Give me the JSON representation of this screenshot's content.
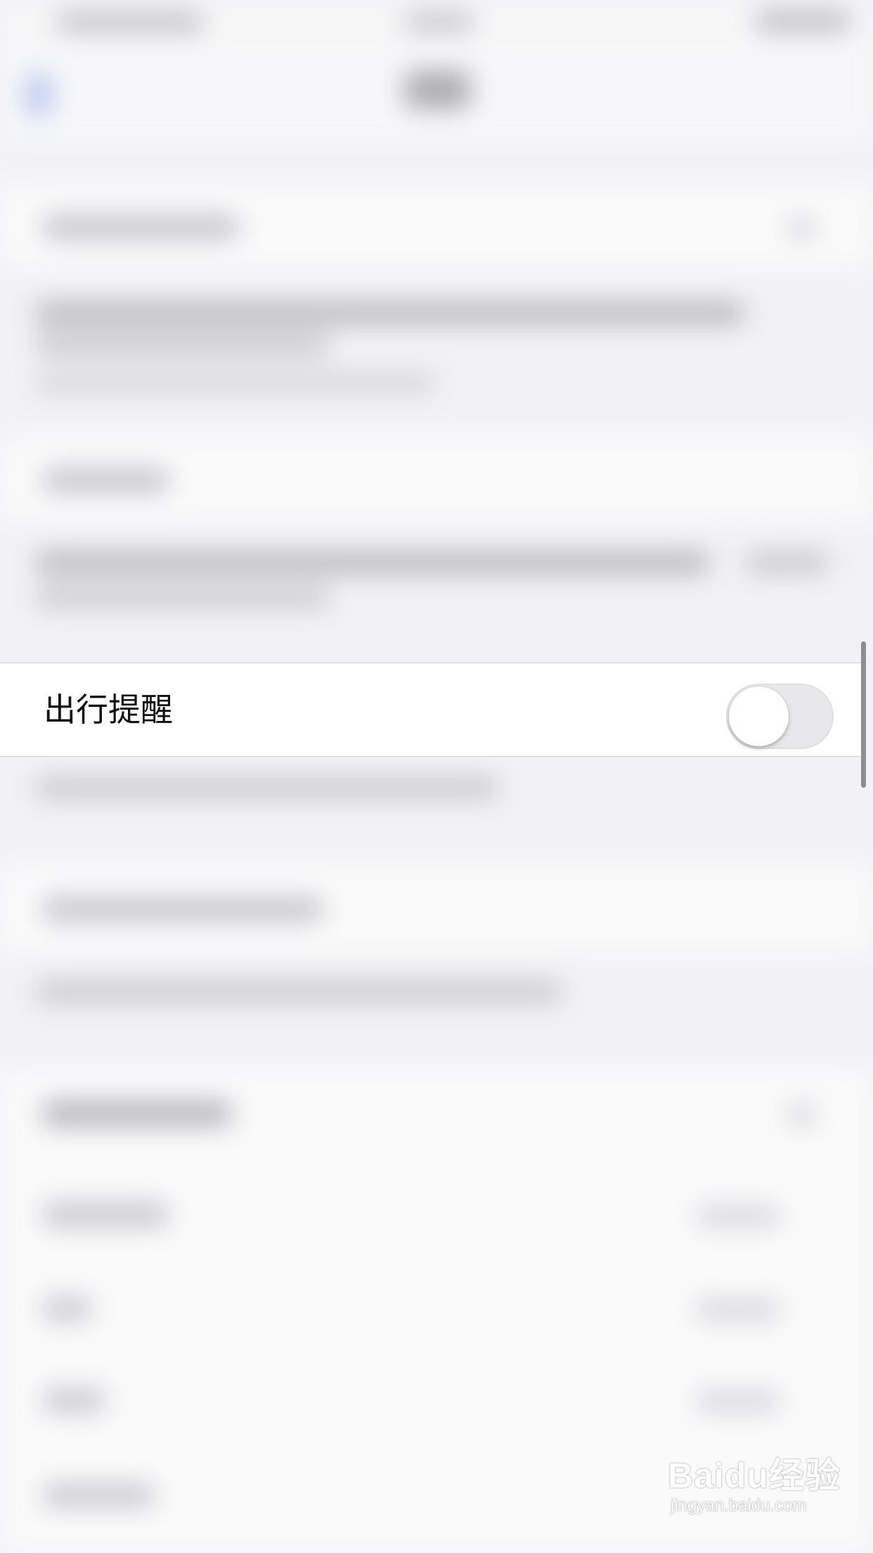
{
  "setting_row": {
    "label": "出行提醒",
    "toggle_state": "off"
  },
  "watermark": {
    "logo": "Baidu经验",
    "url": "jingyan.baidu.com"
  },
  "colors": {
    "background": "#f2f2f4",
    "row_background": "#ffffff",
    "toggle_off_track": "#e8e8ea",
    "scrollbar": "#8e8e92"
  }
}
